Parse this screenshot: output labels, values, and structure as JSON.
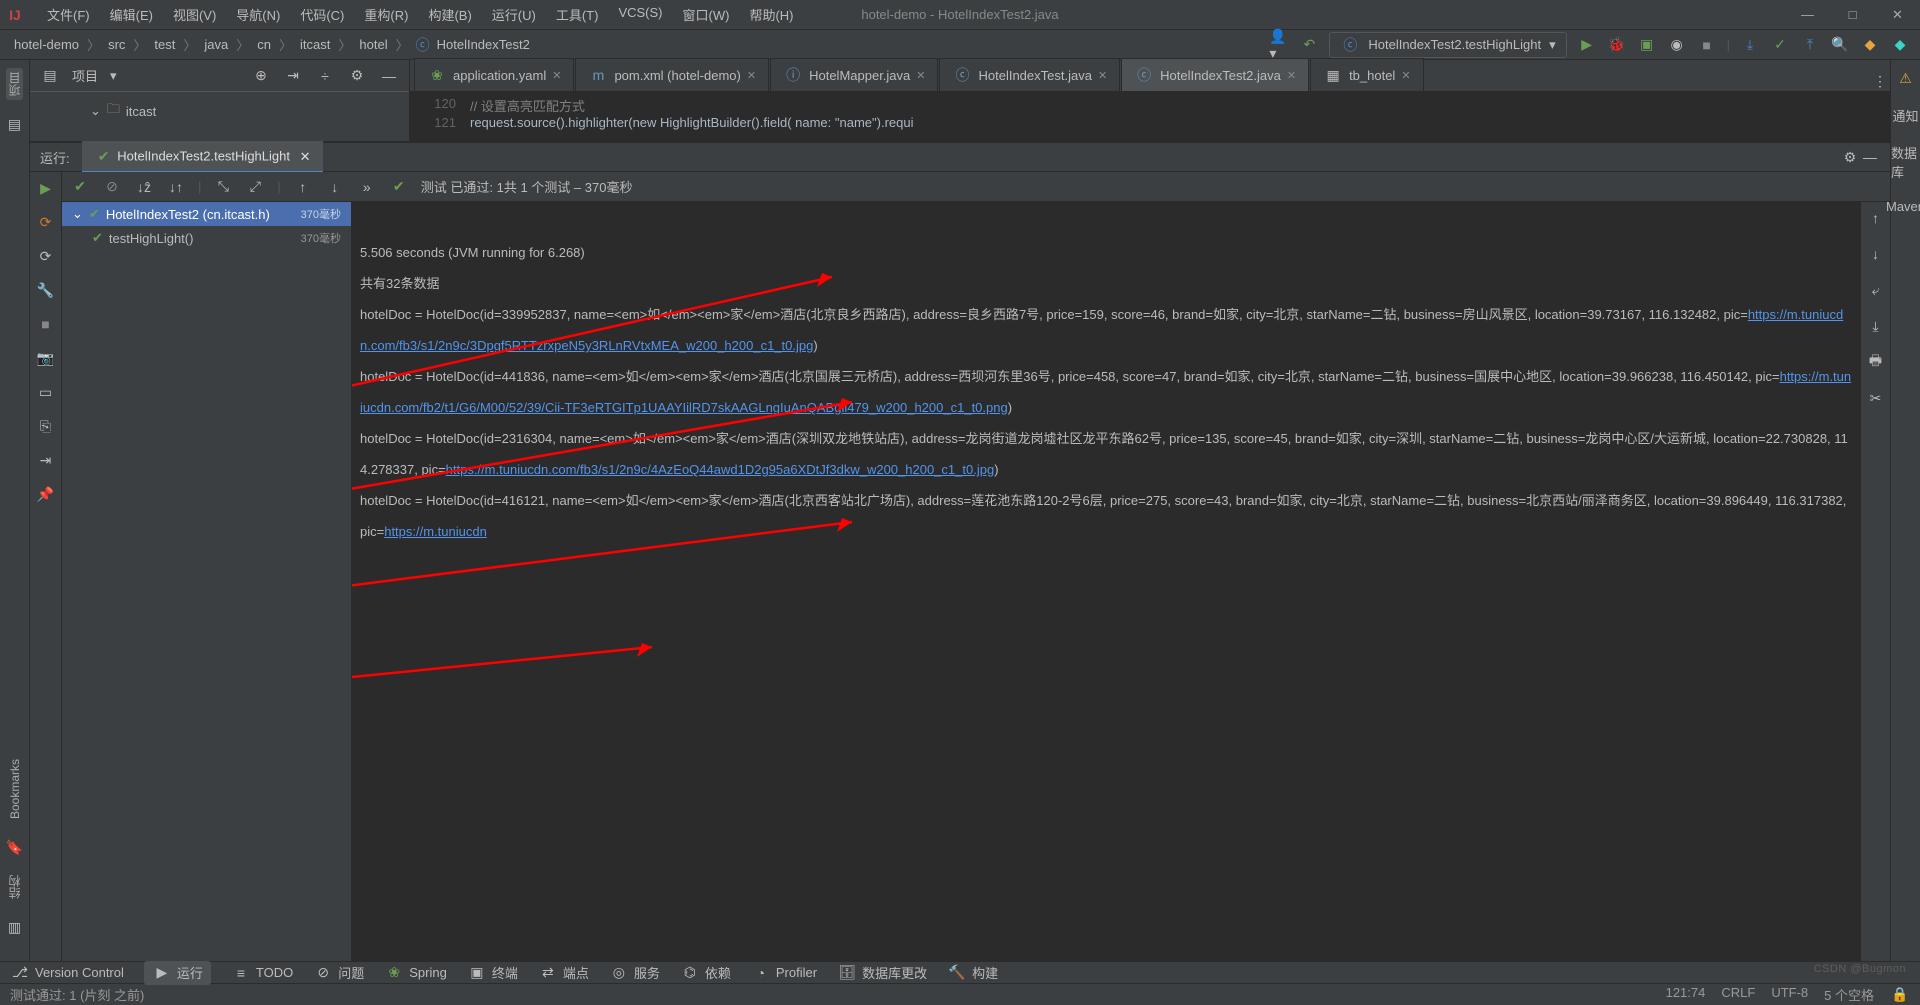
{
  "window": {
    "title": "hotel-demo - HotelIndexTest2.java"
  },
  "menu": [
    "文件(F)",
    "编辑(E)",
    "视图(V)",
    "导航(N)",
    "代码(C)",
    "重构(R)",
    "构建(B)",
    "运行(U)",
    "工具(T)",
    "VCS(S)",
    "窗口(W)",
    "帮助(H)"
  ],
  "breadcrumbs": [
    "hotel-demo",
    "src",
    "test",
    "java",
    "cn",
    "itcast",
    "hotel",
    "HotelIndexTest2"
  ],
  "run_config": "HotelIndexTest2.testHighLight",
  "project": {
    "title": "项目",
    "folder": "itcast"
  },
  "tabs": [
    {
      "label": "application.yaml"
    },
    {
      "label": "pom.xml (hotel-demo)"
    },
    {
      "label": "HotelMapper.java"
    },
    {
      "label": "HotelIndexTest.java"
    },
    {
      "label": "HotelIndexTest2.java",
      "active": true
    },
    {
      "label": "tb_hotel"
    }
  ],
  "code": {
    "l120": "// 设置高亮匹配方式",
    "l121": "request.source().highlighter(new HighlightBuilder().field( name: \"name\").requi"
  },
  "run_window": {
    "title": "运行:",
    "tab": "HotelIndexTest2.testHighLight",
    "toolbar_status": "测试 已通过: 1共 1 个测试 – 370毫秒",
    "tree": [
      {
        "label": "HotelIndexTest2 (cn.itcast.h)",
        "ms": "370毫秒",
        "sel": true
      },
      {
        "label": "testHighLight()",
        "ms": "370毫秒"
      }
    ],
    "console": {
      "line1": "5.506 seconds (JVM running for 6.268)",
      "line2": "共有32条数据",
      "d1a": "hotelDoc = HotelDoc(id=339952837, name=<em>如</em><em>家</em>酒店(北京良乡西路店), address=良乡西路7号, price=159, score=46, brand=如家, city=北京, starName=二钻, business=房山风景区, location=39.73167, 116.132482, pic=",
      "d1l": "https://m.tuniucdn.com/fb3/s1/2n9c/3Dpgf5RTTzrxpeN5y3RLnRVtxMEA_w200_h200_c1_t0.jpg",
      "d1b": ")",
      "d2a": "hotelDoc = HotelDoc(id=441836, name=<em>如</em><em>家</em>酒店(北京国展三元桥店), address=西坝河东里36号, price=458, score=47, brand=如家, city=北京, starName=二钻, business=国展中心地区, location=39.966238, 116.450142, pic=",
      "d2l": "https://m.tuniucdn.com/fb2/t1/G6/M00/52/39/Cii-TF3eRTGITp1UAAYIilRD7skAAGLngIuAnQABgii479_w200_h200_c1_t0.png",
      "d2b": ")",
      "d3a": "hotelDoc = HotelDoc(id=2316304, name=<em>如</em><em>家</em>酒店(深圳双龙地铁站店), address=龙岗街道龙岗墟社区龙平东路62号, price=135, score=45, brand=如家, city=深圳, starName=二钻, business=龙岗中心区/大运新城, location=22.730828, 114.278337, pic=",
      "d3l": "https://m.tuniucdn.com/fb3/s1/2n9c/4AzEoQ44awd1D2g95a6XDtJf3dkw_w200_h200_c1_t0.jpg",
      "d3b": ")",
      "d4a": "hotelDoc = HotelDoc(id=416121, name=<em>如</em><em>家</em>酒店(北京西客站北广场店), address=莲花池东路120-2号6层, price=275, score=43, brand=如家, city=北京, starName=二钻, business=北京西站/丽泽商务区, location=39.896449, 116.317382, pic=",
      "d4l": "https://m.tuniucdn"
    }
  },
  "bottom_tools": [
    {
      "label": "Version Control"
    },
    {
      "label": "运行",
      "hl": true
    },
    {
      "label": "TODO"
    },
    {
      "label": "问题"
    },
    {
      "label": "Spring"
    },
    {
      "label": "终端"
    },
    {
      "label": "端点"
    },
    {
      "label": "服务"
    },
    {
      "label": "依赖"
    },
    {
      "label": "Profiler"
    },
    {
      "label": "数据库更改"
    },
    {
      "label": "构建"
    }
  ],
  "status": {
    "left": "测试通过: 1 (片刻 之前)",
    "pos": "121:74",
    "crlf": "CRLF",
    "enc": "UTF-8",
    "ind": "5 个空格",
    "watermark": "CSDN @Bugmon"
  },
  "side_labels": {
    "project": "项目",
    "bookmarks": "Bookmarks",
    "structure": "结构",
    "notify": "通知",
    "db": "数据库",
    "maven": "Maven"
  }
}
